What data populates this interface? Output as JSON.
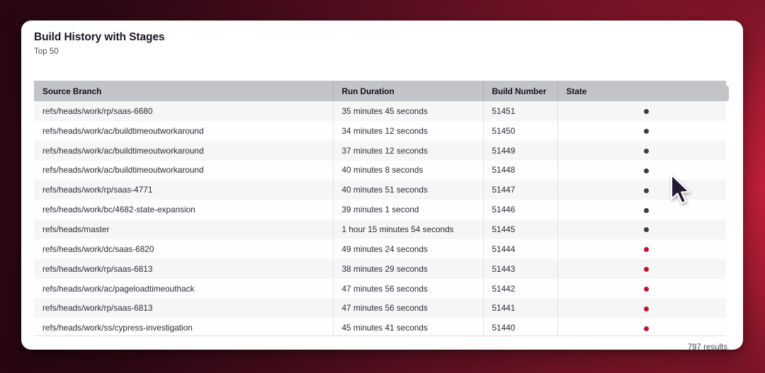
{
  "card": {
    "title": "Build History with Stages",
    "subtitle": "Top 50",
    "results_label": "797 results"
  },
  "table": {
    "columns": [
      "Source Branch",
      "Run Duration",
      "Build Number",
      "State"
    ],
    "state_colors": {
      "dark": "#3d3b46",
      "red": "#c8102e"
    },
    "rows": [
      {
        "branch": "refs/heads/work/rp/saas-6680",
        "duration": "35 minutes 45 seconds",
        "build": "51451",
        "state": "dark"
      },
      {
        "branch": "refs/heads/work/ac/buildtimeoutworkaround",
        "duration": "34 minutes 12 seconds",
        "build": "51450",
        "state": "dark"
      },
      {
        "branch": "refs/heads/work/ac/buildtimeoutworkaround",
        "duration": "37 minutes 12 seconds",
        "build": "51449",
        "state": "dark"
      },
      {
        "branch": "refs/heads/work/ac/buildtimeoutworkaround",
        "duration": "40 minutes 8 seconds",
        "build": "51448",
        "state": "dark"
      },
      {
        "branch": "refs/heads/work/rp/saas-4771",
        "duration": "40 minutes 51 seconds",
        "build": "51447",
        "state": "dark"
      },
      {
        "branch": "refs/heads/work/bc/4682-state-expansion",
        "duration": "39 minutes 1 second",
        "build": "51446",
        "state": "dark"
      },
      {
        "branch": "refs/heads/master",
        "duration": "1 hour 15 minutes 54 seconds",
        "build": "51445",
        "state": "dark"
      },
      {
        "branch": "refs/heads/work/dc/saas-6820",
        "duration": "49 minutes 24 seconds",
        "build": "51444",
        "state": "red"
      },
      {
        "branch": "refs/heads/work/rp/saas-6813",
        "duration": "38 minutes 29 seconds",
        "build": "51443",
        "state": "red"
      },
      {
        "branch": "refs/heads/work/ac/pageloadtimeouthack",
        "duration": "47 minutes 56 seconds",
        "build": "51442",
        "state": "red"
      },
      {
        "branch": "refs/heads/work/rp/saas-6813",
        "duration": "47 minutes 56 seconds",
        "build": "51441",
        "state": "red"
      },
      {
        "branch": "refs/heads/work/ss/cypress-investigation",
        "duration": "45 minutes 41 seconds",
        "build": "51440",
        "state": "red"
      }
    ]
  }
}
